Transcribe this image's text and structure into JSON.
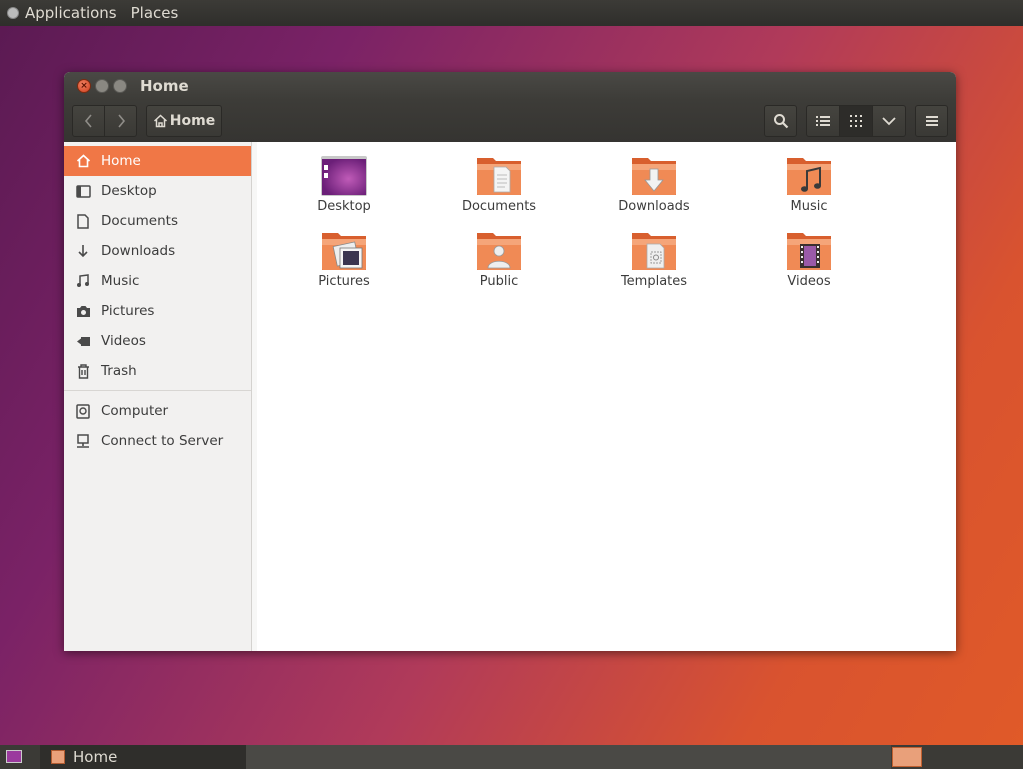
{
  "topbar": {
    "applications_label": "Applications",
    "places_label": "Places"
  },
  "window": {
    "title": "Home",
    "close_glyph": "×"
  },
  "toolbar": {
    "back_icon": "chevron-left-icon",
    "forward_icon": "chevron-right-icon",
    "path_label": "Home",
    "search_icon": "search-icon",
    "list_view_icon": "list-view-icon",
    "grid_view_icon": "grid-view-icon",
    "view_options_icon": "chevron-down-icon",
    "menu_icon": "hamburger-menu-icon"
  },
  "sidebar": {
    "places": [
      {
        "label": "Home",
        "icon": "home-icon",
        "active": true
      },
      {
        "label": "Desktop",
        "icon": "desktop-icon"
      },
      {
        "label": "Documents",
        "icon": "document-icon"
      },
      {
        "label": "Downloads",
        "icon": "download-icon"
      },
      {
        "label": "Music",
        "icon": "music-icon"
      },
      {
        "label": "Pictures",
        "icon": "camera-icon"
      },
      {
        "label": "Videos",
        "icon": "video-icon"
      },
      {
        "label": "Trash",
        "icon": "trash-icon"
      }
    ],
    "devices": [
      {
        "label": "Computer",
        "icon": "computer-icon"
      },
      {
        "label": "Connect to Server",
        "icon": "network-server-icon"
      }
    ]
  },
  "files": [
    {
      "label": "Desktop",
      "icon": "desktop-folder-icon"
    },
    {
      "label": "Documents",
      "icon": "documents-folder-icon"
    },
    {
      "label": "Downloads",
      "icon": "downloads-folder-icon"
    },
    {
      "label": "Music",
      "icon": "music-folder-icon"
    },
    {
      "label": "Pictures",
      "icon": "pictures-folder-icon"
    },
    {
      "label": "Public",
      "icon": "public-folder-icon"
    },
    {
      "label": "Templates",
      "icon": "templates-folder-icon"
    },
    {
      "label": "Videos",
      "icon": "videos-folder-icon"
    }
  ],
  "taskbar": {
    "task_label": "Home"
  },
  "colors": {
    "accent": "#f07746",
    "folder": "#e9743f"
  }
}
